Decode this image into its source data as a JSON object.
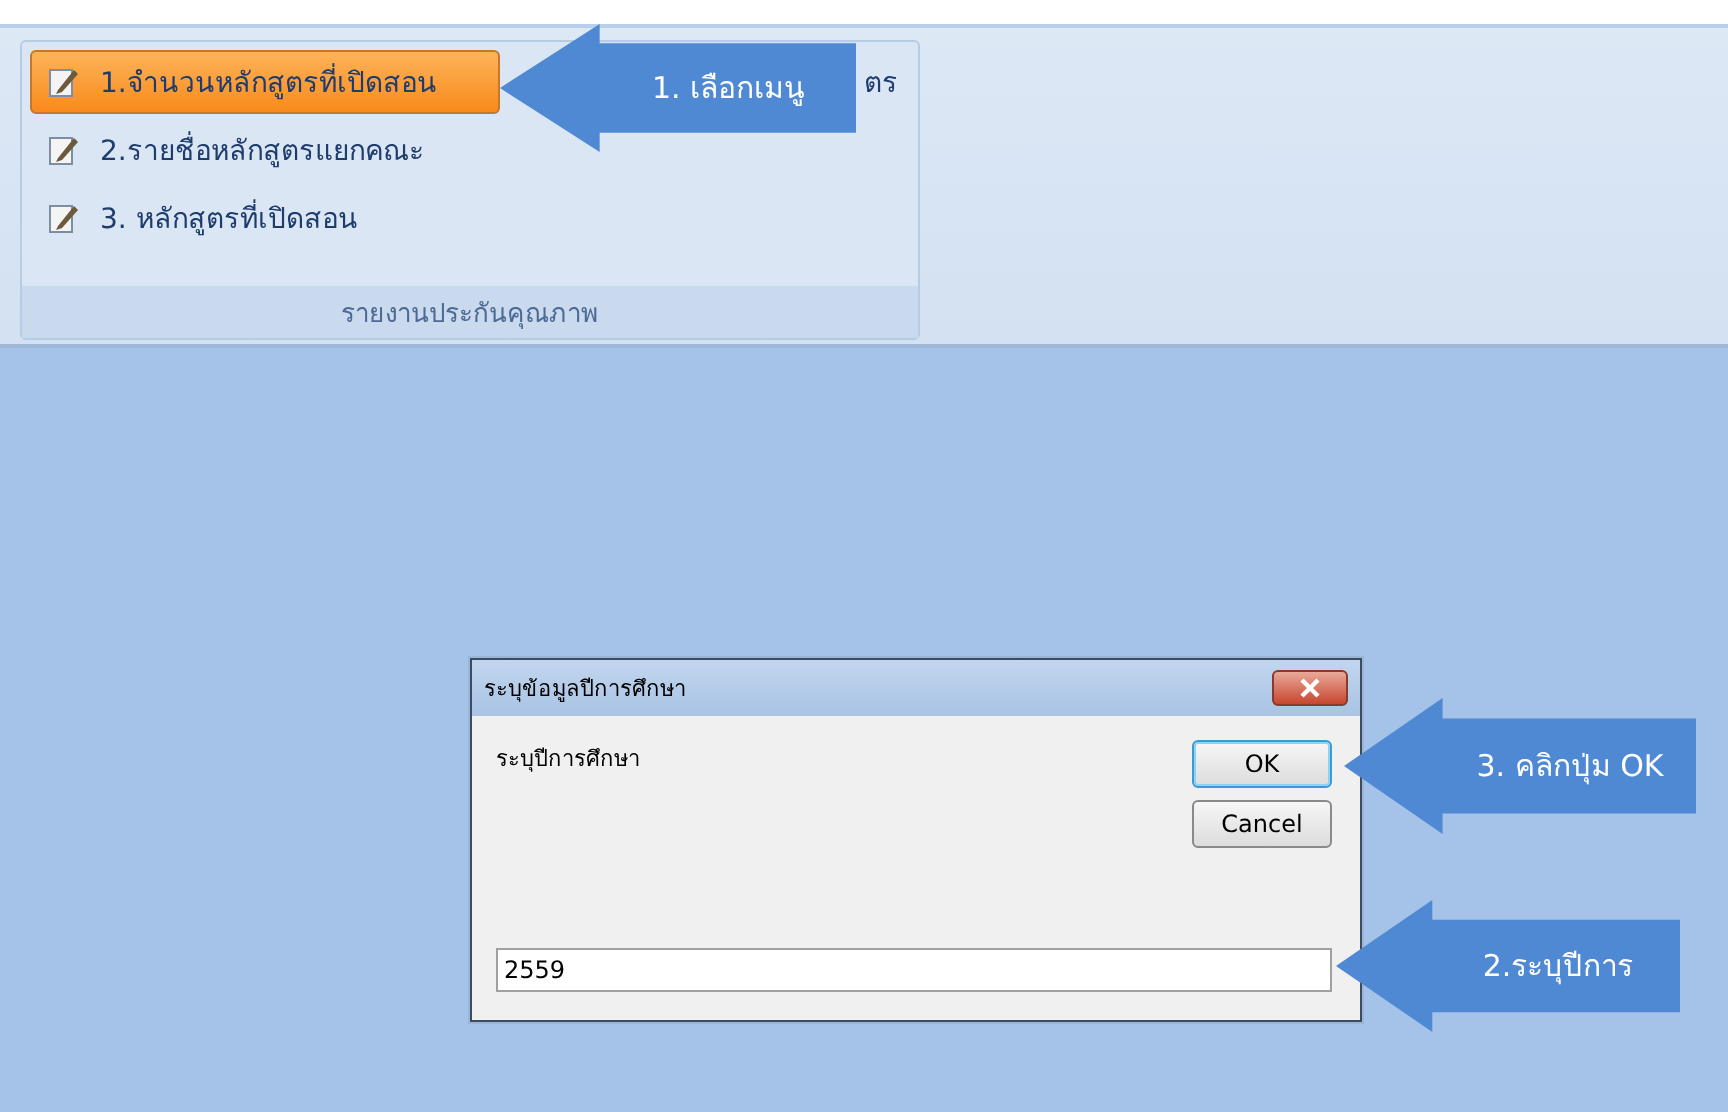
{
  "ribbon": {
    "group": {
      "title": "รายงานประกันคุณภาพ",
      "items": [
        {
          "label": "1.จำนวนหลักสูตรที่เปิดสอน",
          "selected": true
        },
        {
          "label": "2.รายชื่อหลักสูตรแยกคณะ",
          "selected": false
        },
        {
          "label": "3. หลักสูตรที่เปิดสอน",
          "selected": false
        }
      ],
      "side_item": {
        "label": "ตร"
      }
    }
  },
  "dialog": {
    "title": "ระบุข้อมูลปีการศึกษา",
    "prompt": "ระบุปีการศึกษา",
    "buttons": [
      {
        "label": "OK",
        "focused": true
      },
      {
        "label": "Cancel",
        "focused": false
      }
    ],
    "input": {
      "value": "2559"
    }
  },
  "callouts": [
    {
      "text": "1. เลือกเมนู"
    },
    {
      "text": "3. คลิกปุ่ม OK"
    },
    {
      "text": "2.ระบุปีการ"
    }
  ]
}
